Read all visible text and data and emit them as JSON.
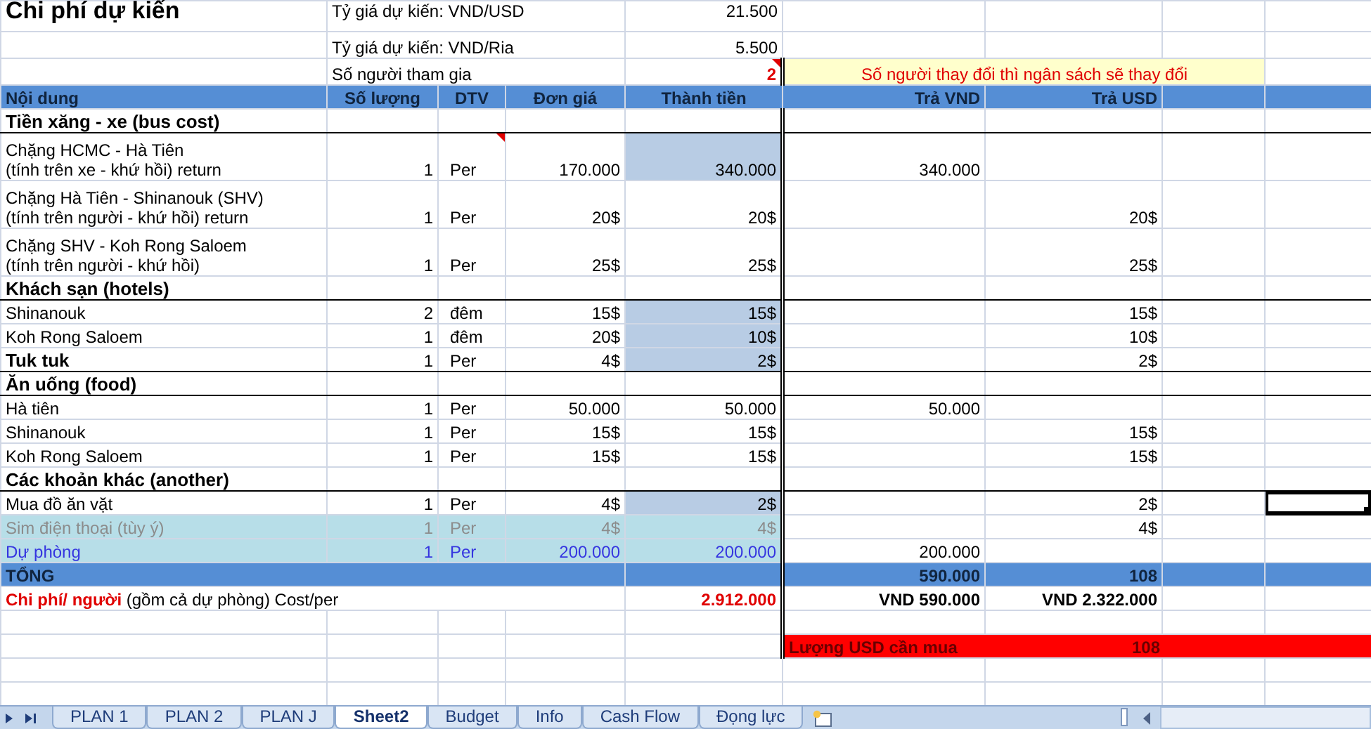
{
  "sheet": {
    "title": "Chi phí dự kiến",
    "settings": [
      {
        "label": "Tỷ giá dự kiến: VND/USD",
        "value": "21.500",
        "kind": "rate",
        "comment": false
      },
      {
        "label": "Tỷ giá dự kiến: VND/Ria",
        "value": "5.500",
        "kind": "rate",
        "comment": false
      },
      {
        "label": "Số người tham gia",
        "value": "2",
        "kind": "people",
        "comment": true
      }
    ],
    "note": "Số người thay đổi thì ngân sách sẽ thay đổi",
    "columns": [
      "Nội dung",
      "Số lượng",
      "DTV",
      "Đơn giá",
      "Thành tiền",
      "Trả VND",
      "Trả USD"
    ],
    "rows": [
      {
        "kind": "section",
        "item": [
          "Tiền xăng - xe (bus cost)"
        ],
        "comment": false,
        "selected": false
      },
      {
        "kind": "item",
        "item": [
          "Chặng HCMC - Hà Tiên",
          "(tính trên xe - khứ hồi) return"
        ],
        "qty": "1",
        "unit": "Per",
        "price": "170.000",
        "amount": "340.000",
        "amount_shaded": true,
        "vnd": "340.000",
        "comment": true,
        "selected": false
      },
      {
        "kind": "item",
        "item": [
          "Chặng Hà Tiên - Shinanouk (SHV)",
          "(tính trên người - khứ hồi) return"
        ],
        "qty": "1",
        "unit": "Per",
        "price": "20$",
        "amount": "20$",
        "amount_shaded": false,
        "usd": "20$",
        "comment": false,
        "selected": false
      },
      {
        "kind": "item",
        "item": [
          "Chặng SHV - Koh Rong Saloem",
          "(tính trên người - khứ hồi)"
        ],
        "qty": "1",
        "unit": "Per",
        "price": "25$",
        "amount": "25$",
        "amount_shaded": false,
        "usd": "25$",
        "comment": false,
        "selected": false
      },
      {
        "kind": "section",
        "item": [
          "Khách sạn (hotels)"
        ],
        "comment": false,
        "selected": false
      },
      {
        "kind": "item",
        "item": [
          "Shinanouk"
        ],
        "qty": "2",
        "unit": "đêm",
        "price": "15$",
        "amount": "15$",
        "amount_shaded": true,
        "usd": "15$",
        "comment": false,
        "selected": false
      },
      {
        "kind": "item",
        "item": [
          "Koh Rong Saloem"
        ],
        "qty": "1",
        "unit": "đêm",
        "price": "20$",
        "amount": "10$",
        "amount_shaded": true,
        "usd": "10$",
        "comment": false,
        "selected": false
      },
      {
        "kind": "bold_item",
        "item": [
          "Tuk tuk"
        ],
        "qty": "1",
        "unit": "Per",
        "price": "4$",
        "amount": "2$",
        "amount_shaded": true,
        "usd": "2$",
        "comment": false,
        "selected": false
      },
      {
        "kind": "section",
        "item": [
          "Ăn uống (food)"
        ],
        "comment": false,
        "selected": false
      },
      {
        "kind": "item",
        "item": [
          "Hà tiên"
        ],
        "qty": "1",
        "unit": "Per",
        "price": "50.000",
        "amount": "50.000",
        "amount_shaded": false,
        "vnd": "50.000",
        "comment": false,
        "selected": false
      },
      {
        "kind": "item",
        "item": [
          "Shinanouk"
        ],
        "qty": "1",
        "unit": "Per",
        "price": "15$",
        "amount": "15$",
        "amount_shaded": false,
        "usd": "15$",
        "comment": false,
        "selected": false
      },
      {
        "kind": "item",
        "item": [
          "Koh Rong Saloem"
        ],
        "qty": "1",
        "unit": "Per",
        "price": "15$",
        "amount": "15$",
        "amount_shaded": false,
        "usd": "15$",
        "comment": false,
        "selected": false
      },
      {
        "kind": "section",
        "item": [
          "Các khoản khác (another)"
        ],
        "comment": false,
        "selected": false
      },
      {
        "kind": "item",
        "item": [
          "Mua đồ ăn vặt"
        ],
        "qty": "1",
        "unit": "Per",
        "price": "4$",
        "amount": "2$",
        "amount_shaded": true,
        "usd": "2$",
        "comment": false,
        "selected": true
      },
      {
        "kind": "optional",
        "item": [
          "Sim điện thoại (tùy ý)"
        ],
        "qty": "1",
        "unit": "Per",
        "price": "4$",
        "amount": "4$",
        "amount_shaded": false,
        "usd": "4$",
        "comment": false,
        "selected": false
      },
      {
        "kind": "reserve",
        "item": [
          "Dự phòng"
        ],
        "qty": "1",
        "unit": "Per",
        "price": "200.000",
        "amount": "200.000",
        "amount_shaded": false,
        "vnd": "200.000",
        "comment": false,
        "selected": false
      }
    ],
    "total": {
      "label": "TỔNG",
      "vnd": "590.000",
      "usd": "108"
    },
    "per_person": {
      "label": "**Chi phí/ người** (gồm cả dự phòng) Cost/per",
      "amount": "2.912.000",
      "vnd": "VND 590.000",
      "usd": "VND 2.322.000"
    },
    "usd_to_buy": {
      "label": "Lượng USD cần mua",
      "value": "108"
    }
  },
  "sheet_tabs": [
    {
      "label": "PLAN 1",
      "selected": false
    },
    {
      "label": "PLAN 2",
      "selected": false
    },
    {
      "label": "PLAN J",
      "selected": false
    },
    {
      "label": "Sheet2",
      "selected": true
    },
    {
      "label": "Budget",
      "selected": false
    },
    {
      "label": "Info",
      "selected": false
    },
    {
      "label": "Cash Flow",
      "selected": false
    },
    {
      "label": "Đọng lực",
      "selected": false
    }
  ]
}
